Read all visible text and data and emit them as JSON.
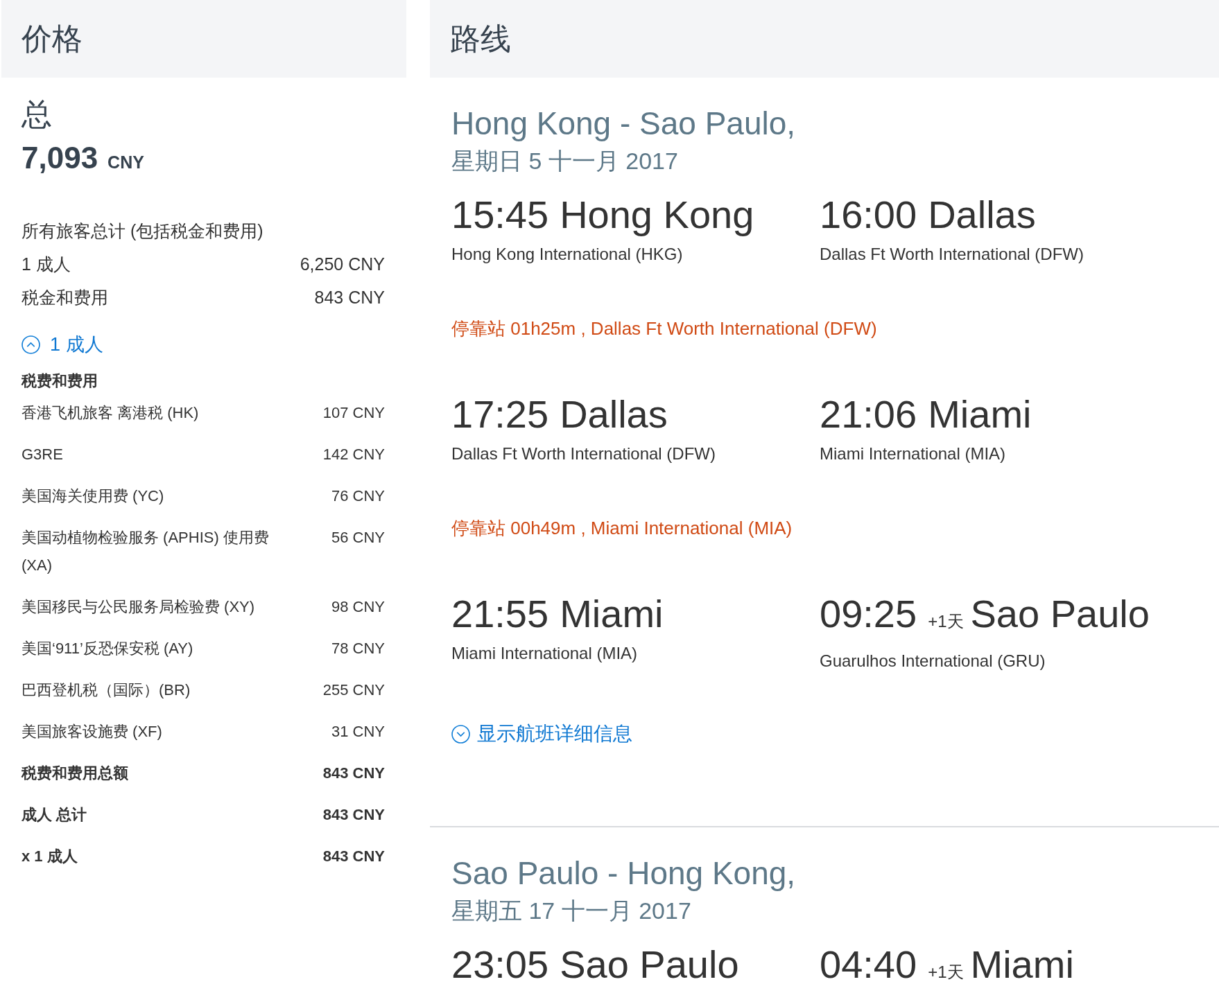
{
  "price": {
    "title": "价格",
    "total_label": "总",
    "total_amount": "7,093",
    "total_currency": "CNY",
    "summary_label": "所有旅客总计 (包括税金和费用)",
    "summary_rows": [
      {
        "label": "1 成人",
        "amount": "6,250 CNY"
      },
      {
        "label": "税金和费用",
        "amount": "843 CNY"
      }
    ],
    "toggle": {
      "label": "1 成人",
      "expanded": true
    },
    "breakdown_title": "税费和费用",
    "fees": [
      {
        "kind": "item",
        "label": "香港飞机旅客 离港税 (HK)",
        "amount": "107 CNY"
      },
      {
        "kind": "item",
        "label": "G3RE",
        "amount": "142 CNY"
      },
      {
        "kind": "item",
        "label": "美国海关使用费 (YC)",
        "amount": "76 CNY"
      },
      {
        "kind": "item",
        "label": "美国动植物检验服务 (APHIS) 使用费 (XA)",
        "amount": "56 CNY"
      },
      {
        "kind": "item",
        "label": "美国移民与公民服务局检验费 (XY)",
        "amount": "98 CNY"
      },
      {
        "kind": "item",
        "label": "美国‘911’反恐保安税 (AY)",
        "amount": "78 CNY"
      },
      {
        "kind": "item",
        "label": "巴西登机税（国际）(BR)",
        "amount": "255 CNY"
      },
      {
        "kind": "item",
        "label": "美国旅客设施费 (XF)",
        "amount": "31 CNY"
      },
      {
        "kind": "total",
        "label": "税费和费用总额",
        "amount": "843 CNY"
      },
      {
        "kind": "total",
        "label": "成人 总计",
        "amount": "843 CNY"
      },
      {
        "kind": "total",
        "label": "x 1 成人",
        "amount": "843 CNY"
      }
    ]
  },
  "route": {
    "title": "路线",
    "legs": [
      {
        "title": "Hong Kong - Sao Paulo,",
        "date": "星期日 5 十一月 2017",
        "items": [
          {
            "kind": "segment",
            "dep_time": "15:45",
            "dep_city": "Hong Kong",
            "dep_airport": "Hong Kong International (HKG)",
            "arr_time": "16:00",
            "arr_city": "Dallas",
            "arr_airport": "Dallas Ft Worth International (DFW)"
          },
          {
            "kind": "layover",
            "label": "停靠站 01h25m , Dallas Ft Worth International (DFW)"
          },
          {
            "kind": "segment",
            "dep_time": "17:25",
            "dep_city": "Dallas",
            "dep_airport": "Dallas Ft Worth International (DFW)",
            "arr_time": "21:06",
            "arr_city": "Miami",
            "arr_airport": "Miami International (MIA)"
          },
          {
            "kind": "layover",
            "label": "停靠站 00h49m , Miami International (MIA)"
          },
          {
            "kind": "segment",
            "dep_time": "21:55",
            "dep_city": "Miami",
            "dep_airport": "Miami International (MIA)",
            "arr_time": "09:25",
            "arr_day_offset": "+1天",
            "arr_city": "Sao Paulo",
            "arr_airport": "Guarulhos International (GRU)"
          }
        ],
        "details_link": {
          "label": "显示航班详细信息",
          "expanded": false
        }
      },
      {
        "title": "Sao Paulo - Hong Kong,",
        "date": "星期五 17 十一月 2017",
        "items": [
          {
            "kind": "segment",
            "dep_time": "23:05",
            "dep_city": "Sao Paulo",
            "arr_time": "04:40",
            "arr_day_offset": "+1天",
            "arr_city": "Miami"
          }
        ]
      }
    ]
  }
}
